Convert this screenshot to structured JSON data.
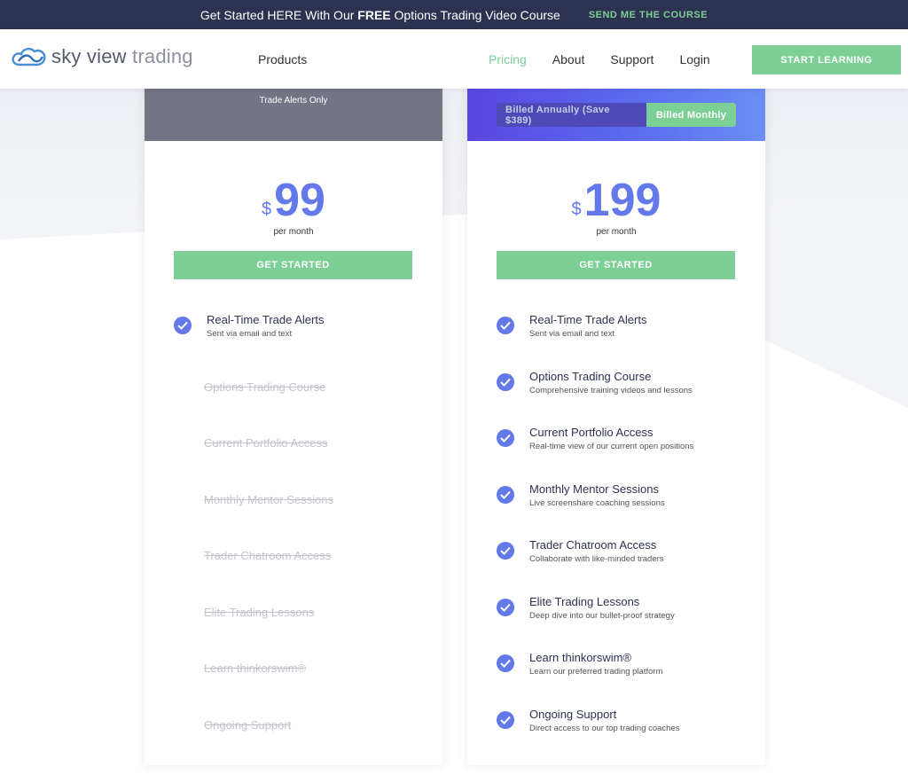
{
  "announcement": {
    "text_before": "Get Started HERE With Our ",
    "text_bold": "FREE",
    "text_after": " Options Trading Video Course",
    "link": "SEND ME THE COURSE"
  },
  "header": {
    "logo_primary": "sky view ",
    "logo_secondary": "trading",
    "nav_products": "Products",
    "nav": [
      "Pricing",
      "About",
      "Support",
      "Login"
    ],
    "active_nav": "Pricing",
    "cta": "START LEARNING"
  },
  "colors": {
    "accent_green": "#7ccf95",
    "accent_blue": "#6379ea",
    "dark_navy": "#2d3250"
  },
  "plans": [
    {
      "head_subtitle": "Trade Alerts Only",
      "currency": "$",
      "price": "99",
      "period": "per month",
      "button": "GET STARTED",
      "features": [
        {
          "title": "Real-Time Trade Alerts",
          "desc": "Sent via email and text",
          "included": true
        },
        {
          "title": "Options Trading Course",
          "included": false
        },
        {
          "title": "Current Portfolio Access",
          "included": false
        },
        {
          "title": "Monthly Mentor Sessions",
          "included": false
        },
        {
          "title": "Trader Chatroom Access",
          "included": false
        },
        {
          "title": "Elite Trading Lessons",
          "included": false
        },
        {
          "title": "Learn thinkorswim®",
          "included": false
        },
        {
          "title": "Ongoing Support",
          "included": false
        }
      ]
    },
    {
      "toggle_annual": "Billed Annually (Save $389)",
      "toggle_monthly": "Billed Monthly",
      "currency": "$",
      "price": "199",
      "period": "per month",
      "button": "GET STARTED",
      "features": [
        {
          "title": "Real-Time Trade Alerts",
          "desc": "Sent via email and text",
          "included": true
        },
        {
          "title": "Options Trading Course",
          "desc": "Comprehensive training videos and lessons",
          "included": true
        },
        {
          "title": "Current Portfolio Access",
          "desc": "Real-time view of our current open positions",
          "included": true
        },
        {
          "title": "Monthly Mentor Sessions",
          "desc": "Live screenshare coaching sessions",
          "included": true
        },
        {
          "title": "Trader Chatroom Access",
          "desc": "Collaborate with like-minded traders",
          "included": true
        },
        {
          "title": "Elite Trading Lessons",
          "desc": "Deep dive into our bullet-proof strategy",
          "included": true
        },
        {
          "title": "Learn thinkorswim®",
          "desc": "Learn our preferred trading platform",
          "included": true
        },
        {
          "title": "Ongoing Support",
          "desc": "Direct access to our top trading coaches",
          "included": true
        }
      ]
    }
  ]
}
